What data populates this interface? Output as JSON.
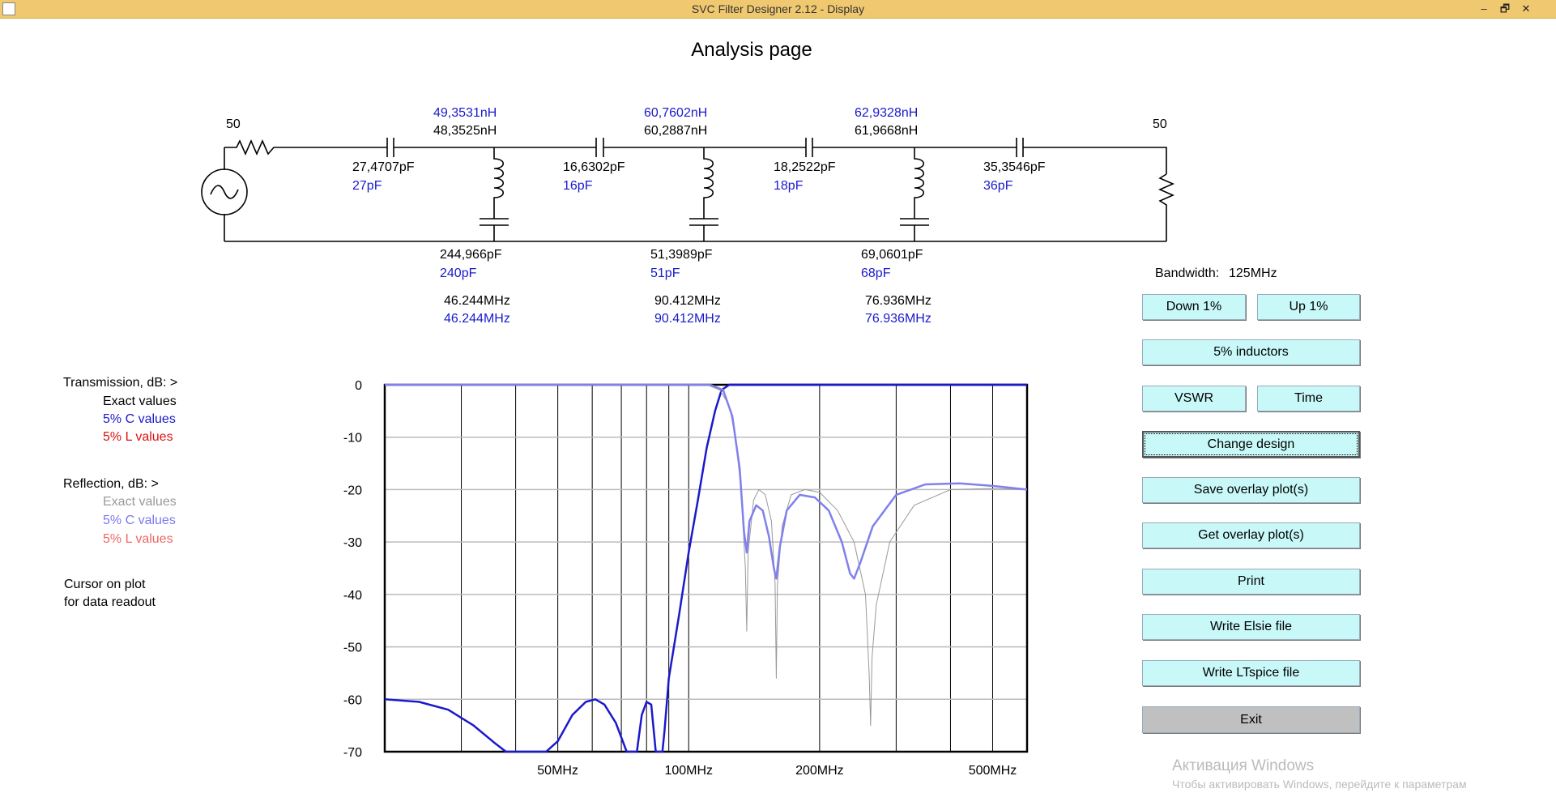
{
  "window": {
    "title": "SVC Filter Designer 2.12 - Display",
    "minimize_label": "–",
    "restore_label": "🗗",
    "close_label": "✕"
  },
  "page_title": "Analysis page",
  "circuit": {
    "source_r": "50",
    "load_r": "50",
    "series_l": [
      {
        "exact": "48,3525nH",
        "std": "49,3531nH"
      },
      {
        "exact": "60,2887nH",
        "std": "60,7602nH"
      },
      {
        "exact": "61,9668nH",
        "std": "62,9328nH"
      }
    ],
    "series_c": [
      {
        "exact": "27,4707pF",
        "std": "27pF"
      },
      {
        "exact": "16,6302pF",
        "std": "16pF"
      },
      {
        "exact": "18,2522pF",
        "std": "18pF"
      },
      {
        "exact": "35,3546pF",
        "std": "36pF"
      }
    ],
    "shunt_c": [
      {
        "exact": "244,966pF",
        "std": "240pF"
      },
      {
        "exact": "51,3989pF",
        "std": "51pF"
      },
      {
        "exact": "69,0601pF",
        "std": "68pF"
      }
    ],
    "resonance": [
      {
        "exact": "46.244MHz",
        "std": "46.244MHz"
      },
      {
        "exact": "90.412MHz",
        "std": "90.412MHz"
      },
      {
        "exact": "76.936MHz",
        "std": "76.936MHz"
      }
    ]
  },
  "legend": {
    "transmission_label": "Transmission, dB:  >",
    "t_exact": "Exact values",
    "t_5c": "5% C values",
    "t_5l": "5% L values",
    "reflection_label": "Reflection, dB:  >",
    "r_exact": "Exact values",
    "r_5c": "5% C values",
    "r_5l": "5% L values",
    "cursor_line1": "Cursor on plot",
    "cursor_line2": "for data readout"
  },
  "bandwidth": {
    "label": "Bandwidth:",
    "value": "125MHz"
  },
  "buttons": {
    "down": "Down 1%",
    "up": "Up 1%",
    "inductors": "5% inductors",
    "vswr": "VSWR",
    "time": "Time",
    "change_design": "Change design",
    "save_overlay": "Save overlay plot(s)",
    "get_overlay": "Get overlay plot(s)",
    "print": "Print",
    "write_elsie": "Write Elsie file",
    "write_ltspice": "Write LTspice file",
    "exit": "Exit"
  },
  "watermark": {
    "line1": "Активация Windows",
    "line2": "Чтобы активировать Windows, перейдите к параметрам"
  },
  "colors": {
    "transmission_5c": "#1a1acc",
    "reflection_5c": "#8080ee",
    "reflection_exact": "#999999",
    "button_face": "#c8f8f8",
    "titlebar": "#f0c870"
  },
  "chart_data": {
    "type": "line",
    "x_scale": "log",
    "xlim": [
      20,
      600
    ],
    "ylim": [
      -70,
      0
    ],
    "x_tick_labels": [
      "50MHz",
      "100MHz",
      "200MHz",
      "500MHz"
    ],
    "x_tick_values": [
      50,
      100,
      200,
      500
    ],
    "y_ticks": [
      0,
      -10,
      -20,
      -30,
      -40,
      -50,
      -60,
      -70
    ],
    "y_tick_labels": [
      "0",
      "-10",
      "-20",
      "-30",
      "-40",
      "-50",
      "-60",
      "-70"
    ],
    "grid": true,
    "series": [
      {
        "name": "5% C values",
        "color": "#1a1acc",
        "width": 2.5,
        "points": [
          [
            20,
            -60
          ],
          [
            24,
            -60.5
          ],
          [
            28,
            -62
          ],
          [
            32,
            -65
          ],
          [
            36,
            -68.5
          ],
          [
            38,
            -70
          ],
          [
            47,
            -70
          ],
          [
            50,
            -68
          ],
          [
            54,
            -63
          ],
          [
            58,
            -60.5
          ],
          [
            61,
            -60
          ],
          [
            64,
            -61
          ],
          [
            68,
            -64.5
          ],
          [
            72,
            -70
          ],
          [
            76,
            -70
          ],
          [
            78,
            -63
          ],
          [
            80,
            -60.5
          ],
          [
            82,
            -61
          ],
          [
            84,
            -70
          ],
          [
            87,
            -70
          ],
          [
            88,
            -66
          ],
          [
            90,
            -56
          ],
          [
            95,
            -44
          ],
          [
            100,
            -32
          ],
          [
            105,
            -22
          ],
          [
            110,
            -12
          ],
          [
            115,
            -5
          ],
          [
            119,
            -1
          ],
          [
            124,
            0
          ],
          [
            130,
            0
          ],
          [
            160,
            0
          ],
          [
            250,
            0
          ],
          [
            600,
            0
          ]
        ]
      },
      {
        "name": "Exact values",
        "color": "#999999",
        "width": 1,
        "points": [
          [
            20,
            0
          ],
          [
            110,
            0
          ],
          [
            118,
            -1
          ],
          [
            124,
            -4
          ],
          [
            128,
            -10
          ],
          [
            132,
            -20
          ],
          [
            135,
            -35
          ],
          [
            136,
            -47
          ],
          [
            137,
            -32
          ],
          [
            141,
            -22
          ],
          [
            145,
            -20
          ],
          [
            150,
            -21
          ],
          [
            155,
            -26
          ],
          [
            158,
            -38
          ],
          [
            159,
            -56
          ],
          [
            160,
            -38
          ],
          [
            164,
            -27
          ],
          [
            172,
            -21
          ],
          [
            185,
            -20
          ],
          [
            200,
            -20.5
          ],
          [
            220,
            -24
          ],
          [
            240,
            -30
          ],
          [
            255,
            -40
          ],
          [
            260,
            -55
          ],
          [
            262,
            -65
          ],
          [
            264,
            -52
          ],
          [
            270,
            -42
          ],
          [
            290,
            -30
          ],
          [
            330,
            -23
          ],
          [
            400,
            -20
          ],
          [
            500,
            -19.8
          ],
          [
            600,
            -20
          ]
        ]
      },
      {
        "name": "5% C values",
        "color": "#8080ee",
        "width": 2.5,
        "points": [
          [
            20,
            0
          ],
          [
            112,
            0
          ],
          [
            120,
            -1
          ],
          [
            126,
            -6
          ],
          [
            131,
            -16
          ],
          [
            134,
            -28
          ],
          [
            136,
            -32
          ],
          [
            138,
            -26
          ],
          [
            143,
            -23
          ],
          [
            148,
            -24
          ],
          [
            153,
            -29
          ],
          [
            157,
            -35
          ],
          [
            159,
            -37
          ],
          [
            162,
            -31
          ],
          [
            168,
            -24
          ],
          [
            180,
            -21
          ],
          [
            195,
            -21.5
          ],
          [
            210,
            -24
          ],
          [
            225,
            -30
          ],
          [
            235,
            -36
          ],
          [
            240,
            -37
          ],
          [
            248,
            -34
          ],
          [
            265,
            -27
          ],
          [
            300,
            -21
          ],
          [
            350,
            -19
          ],
          [
            420,
            -18.8
          ],
          [
            500,
            -19.3
          ],
          [
            600,
            -20
          ]
        ]
      }
    ]
  }
}
